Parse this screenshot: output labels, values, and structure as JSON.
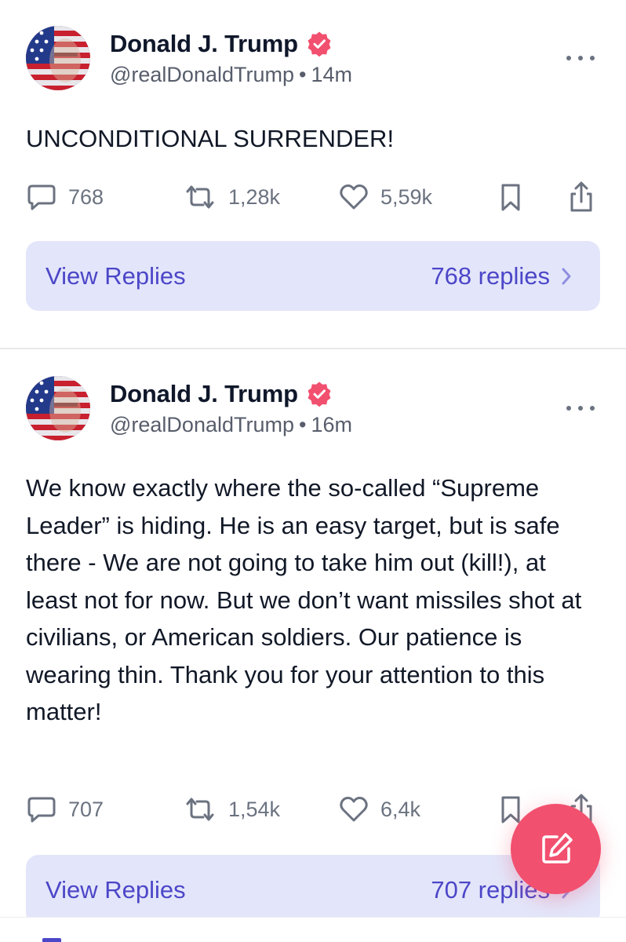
{
  "feed": {
    "posts": [
      {
        "author_name": "Donald J. Trump",
        "handle": "@realDonaldTrump",
        "separator": "•",
        "time": "14m",
        "text": "UNCONDITIONAL SURRENDER!",
        "replies": "768",
        "reposts": "1,28k",
        "likes": "5,59k",
        "view_replies_label": "View Replies",
        "replies_count_label": "768 replies"
      },
      {
        "author_name": "Donald J. Trump",
        "handle": "@realDonaldTrump",
        "separator": "•",
        "time": "16m",
        "text": "We know exactly where the so-called “Supreme Leader” is hiding. He is an easy target, but is safe there - We are not going to take him out (kill!), at least not for now. But we don’t want missiles shot at civilians, or American soldiers. Our patience is wearing thin. Thank you for your attention to this matter!",
        "replies": "707",
        "reposts": "1,54k",
        "likes": "6,4k",
        "view_replies_label": "View Replies",
        "replies_count_label": "707 replies"
      }
    ]
  },
  "icons": {
    "verified": "verified-badge-icon",
    "more": "more-options-icon",
    "reply": "comment-icon",
    "repost": "repost-icon",
    "like": "heart-icon",
    "bookmark": "bookmark-icon",
    "share": "share-icon",
    "chevron": "chevron-right-icon",
    "compose": "compose-icon"
  },
  "colors": {
    "accent": "#4c46c8",
    "verified_badge": "#f2506f",
    "fab": "#f2506f",
    "replies_button_bg": "#e3e6fa",
    "muted_text": "#6b7280"
  }
}
